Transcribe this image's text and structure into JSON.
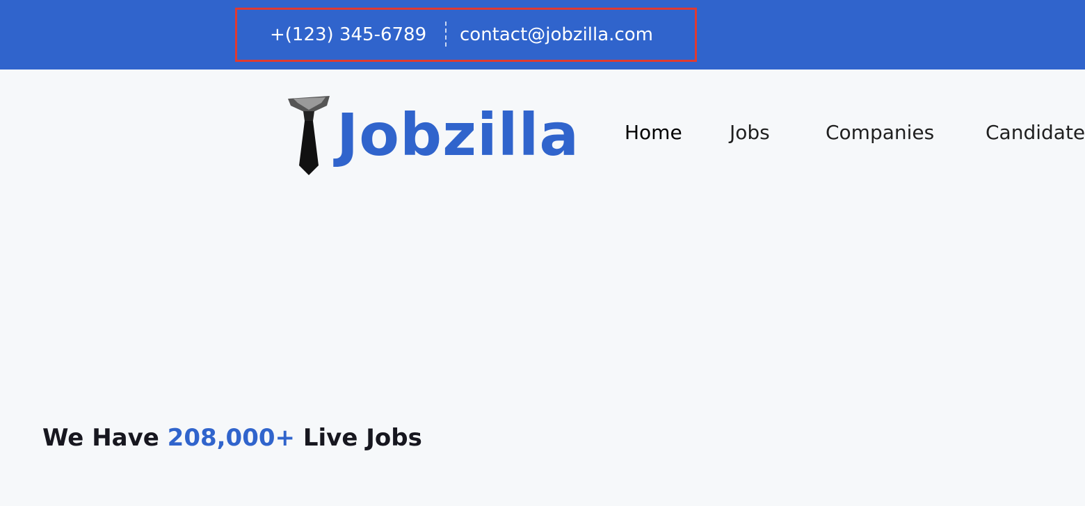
{
  "topbar": {
    "phone": "+(123) 345-6789",
    "email": "contact@jobzilla.com",
    "background_color": "#3064cc",
    "highlight_color": "#e03a30"
  },
  "logo": {
    "text": "Jobzilla",
    "icon": "necktie-icon",
    "color": "#3064cc"
  },
  "nav": {
    "items": [
      {
        "label": "Home"
      },
      {
        "label": "Jobs"
      },
      {
        "label": "Companies"
      },
      {
        "label": "Candidates"
      }
    ]
  },
  "hero": {
    "title_prefix": "We Have",
    "title_highlight": "208,000+",
    "title_suffix": "Live Jobs"
  }
}
